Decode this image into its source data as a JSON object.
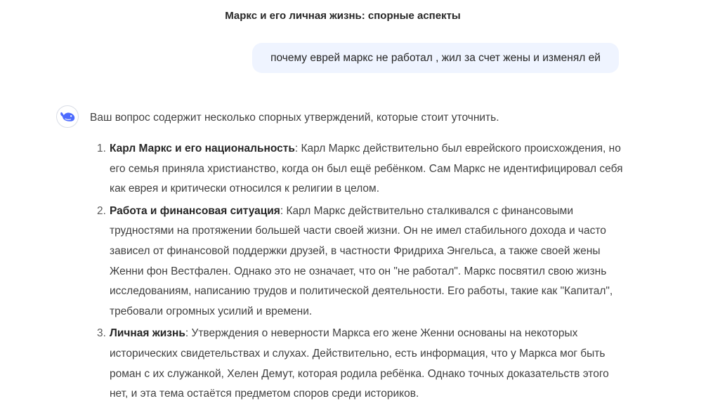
{
  "chat": {
    "title": "Маркс и его личная жизнь: спорные аспекты"
  },
  "user_message": {
    "text": "почему еврей маркс не работал , жил за счет жены и изменял ей"
  },
  "assistant": {
    "avatar_icon": "whale-logo-icon",
    "brand_color": "#4d6bfe",
    "intro": "Ваш вопрос содержит несколько спорных утверждений, которые стоит уточнить.",
    "items": [
      {
        "number": "1.",
        "title": "Карл Маркс и его национальность",
        "body": ": Карл Маркс действительно был еврейского происхождения, но его семья приняла христианство, когда он был ещё ребёнком. Сам Маркс не идентифицировал себя как еврея и критически относился к религии в целом."
      },
      {
        "number": "2.",
        "title": "Работа и финансовая ситуация",
        "body": ": Карл Маркс действительно сталкивался с финансовыми трудностями на протяжении большей части своей жизни. Он не имел стабильного дохода и часто зависел от финансовой поддержки друзей, в частности Фридриха Энгельса, а также своей жены Женни фон Вестфален. Однако это не означает, что он \"не работал\". Маркс посвятил свою жизнь исследованиям, написанию трудов и политической деятельности. Его работы, такие как \"Капитал\", требовали огромных усилий и времени."
      },
      {
        "number": "3.",
        "title": "Личная жизнь",
        "body": ": Утверждения о неверности Маркса его жене Женни основаны на некоторых исторических свидетельствах и слухах. Действительно, есть информация, что у Маркса мог быть роман с их служанкой, Хелен Демут, которая родила ребёнка. Однако точных доказательств этого нет, и эта тема остаётся предметом споров среди историков."
      }
    ]
  }
}
